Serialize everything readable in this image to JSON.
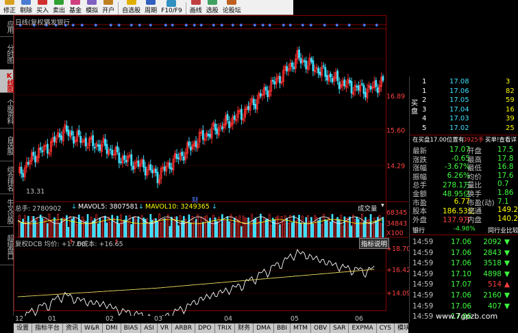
{
  "toolbar": {
    "items": [
      {
        "label": "修正",
        "color": "#d8a020"
      },
      {
        "label": "剔除",
        "color": "#4a7bd0"
      },
      {
        "label": "买入",
        "color": "#d03030"
      },
      {
        "label": "卖出",
        "color": "#30a030"
      },
      {
        "label": "基金",
        "color": "#d04080"
      },
      {
        "label": "模拟",
        "color": "#8060c0"
      },
      {
        "label": "开户",
        "color": "#c08020"
      },
      {
        "label": "自选股",
        "color": "#e0b000"
      },
      {
        "label": "周期",
        "color": "#3060c0"
      },
      {
        "label": "F10/F9",
        "color": "#3090c0"
      },
      {
        "label": "画线",
        "color": "#c04040"
      },
      {
        "label": "选股",
        "color": "#40a060"
      },
      {
        "label": "论股坛",
        "color": "#c06020"
      }
    ]
  },
  "left_tabs": [
    {
      "label": "应用",
      "active": false
    },
    {
      "label": "分时图",
      "active": false
    },
    {
      "label": "K线图",
      "active": true
    },
    {
      "label": "个股资料",
      "active": false
    },
    {
      "label": "自选股",
      "active": false
    },
    {
      "label": "综合排名",
      "active": false
    },
    {
      "label": "牛叉诊股",
      "active": false
    },
    {
      "label": "超级盘口",
      "active": false
    }
  ],
  "chart": {
    "header": "日线(复权)",
    "header_sub": "满发银行",
    "price_labels": [
      "16.89",
      "15.60",
      "14.29"
    ],
    "low_marker": "13.31",
    "event_marker": "财",
    "volume_title": "总手: 2780902",
    "mavol5": "MAVOL5: 3807581",
    "mavol10": "MAVOL10: 3249365",
    "vol_selector": "成交量",
    "vol_labels": [
      "68345",
      "34843",
      "X100"
    ],
    "dcb_title": "复权DCB 均价: +17.60",
    "dcb_cost": "D成本: +16.65",
    "dcb_btn": "指标说明",
    "dcb_labels": [
      "+18.70",
      "+16.42",
      "+14.09"
    ],
    "x_labels": [
      "12",
      "01",
      "02",
      "03",
      "04",
      "05",
      "06"
    ],
    "colors": {
      "up": "#ff3030",
      "down": "#3fe0ff",
      "grid": "#800000",
      "ma5": "#ffffff",
      "ma10": "#ffff00",
      "event": "#4a7bff"
    }
  },
  "order_book": {
    "sell": [
      {
        "n": "1",
        "price": "17.08",
        "vol": "3"
      },
      {
        "n": "1",
        "price": "17.06",
        "vol": "82"
      },
      {
        "n": "2",
        "price": "17.05",
        "vol": "59"
      },
      {
        "n": "3",
        "price": "17.04",
        "vol": "16"
      },
      {
        "n": "4",
        "price": "17.03",
        "vol": "39"
      },
      {
        "n": "5",
        "price": "17.02",
        "vol": "25"
      }
    ],
    "side_label": "买盘",
    "notice": "在买盘17.00位置有",
    "notice_vol": "3925手",
    "notice_link": "买单!查看详",
    "info": [
      {
        "k1": "最新",
        "v1": "17.07",
        "k2": "开盘",
        "v2": "17.5"
      },
      {
        "k1": "涨跌",
        "v1": "-0.65",
        "k2": "最高",
        "v2": "17.8"
      },
      {
        "k1": "涨幅",
        "v1": "-3.67%",
        "k2": "最低",
        "v2": "16.8"
      },
      {
        "k1": "振幅",
        "v1": "6.26%",
        "k2": "均价",
        "v2": "17.6"
      },
      {
        "k1": "总手",
        "v1": "278.1万",
        "k2": "量比",
        "v2": "0.7"
      },
      {
        "k1": "金额",
        "v1": "48.95亿",
        "k2": "换手",
        "v2": "1.86"
      },
      {
        "k1": "市盈",
        "v1": "6.77",
        "k2": "市盈(动)",
        "v2": "7.1"
      },
      {
        "k1": "股本",
        "v1": "186.53亿",
        "k2": "流通",
        "v2": "149.23"
      },
      {
        "k1": "外盘",
        "v1": "137.9万",
        "k2": "内盘",
        "v2": "140.27"
      }
    ],
    "sector": "银行",
    "sector_change": "-4.98%",
    "sector_link": "同行业比较",
    "ticks": [
      {
        "time": "14:59",
        "price": "17.06",
        "vol": "2092",
        "dir": "down"
      },
      {
        "time": "14:59",
        "price": "17.06",
        "vol": "2843",
        "dir": "down"
      },
      {
        "time": "14:59",
        "price": "17.06",
        "vol": "3518",
        "dir": "down"
      },
      {
        "time": "14:59",
        "price": "17.10",
        "vol": "4898",
        "dir": "down"
      },
      {
        "time": "14:59",
        "price": "17.07",
        "vol": "514",
        "dir": "up"
      },
      {
        "time": "14:59",
        "price": "17.06",
        "vol": "2160",
        "dir": "down"
      },
      {
        "time": "14:59",
        "price": "17.06",
        "vol": "407",
        "dir": "down"
      },
      {
        "time": "14:59",
        "price": "17.06",
        "vol": "",
        "dir": ""
      }
    ]
  },
  "bottom_tabs": [
    "设置",
    "指标平台",
    "资讯",
    "W&R",
    "DMI",
    "BIAS",
    "ASI",
    "VR",
    "ARBR",
    "DPO",
    "TRIX",
    "财务",
    "DMA",
    "BBI",
    "MTM",
    "OBV",
    "SAR",
    "EXPMA",
    "CYS",
    "模块",
    "复权DCB"
  ],
  "active_bottom_tab": "复权DCB",
  "watermark": "www.7gpzb.com"
}
